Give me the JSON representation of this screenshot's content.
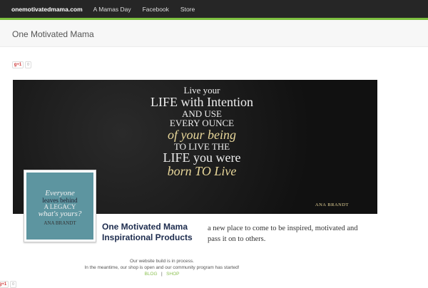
{
  "nav": {
    "brand": "onemotivatedmama.com",
    "items": [
      "A Mamas Day",
      "Facebook",
      "Store"
    ]
  },
  "header": {
    "title": "One Motivated Mama"
  },
  "gplus": {
    "label": "g+1",
    "count": "0"
  },
  "banner": {
    "lines": [
      "Live your",
      "LIFE with Intention",
      "AND USE",
      "EVERY OUNCE",
      "of your being",
      "TO LIVE THE",
      "LIFE you were",
      "born TO Live"
    ],
    "author": "ANA BRANDT"
  },
  "profile_pic": {
    "lines": [
      "Everyone",
      "leaves behind",
      "A LEGACY",
      "what's yours?"
    ],
    "author": "ANA BRANDT"
  },
  "page": {
    "title_line1": "One Motivated Mama",
    "title_line2": "Inspirational Products",
    "description": "a new place to come to be inspired, motivated and pass it on to others."
  },
  "footer": {
    "line1": "Our website build is in process.",
    "line2": "In the meantime, our shop is open and our community program has started!",
    "blog": "BLOG",
    "sep": "|",
    "shop": "SHOP"
  },
  "colors": {
    "accent": "#7dbf3f",
    "nav_bg": "#262626"
  }
}
